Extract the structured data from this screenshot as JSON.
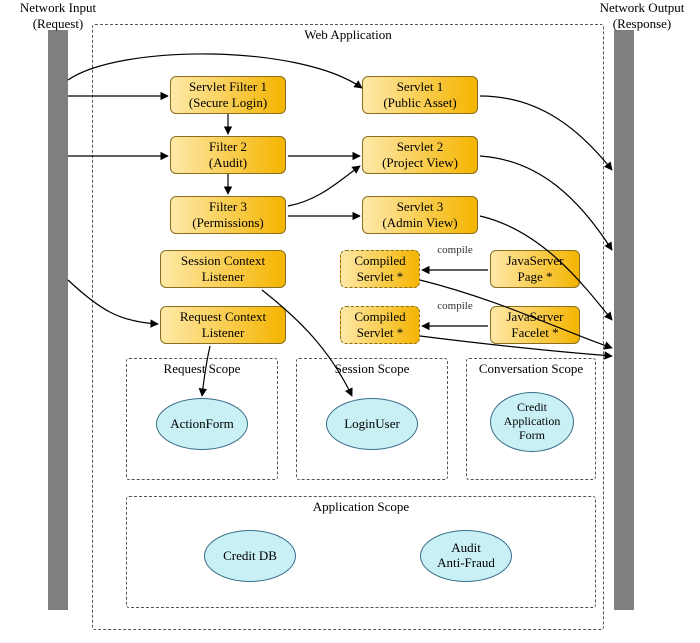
{
  "labels": {
    "network_input": "Network Input\n(Request)",
    "network_output": "Network Output\n(Response)",
    "web_application": "Web Application",
    "compile": "compile"
  },
  "filters": {
    "f1": "Servlet Filter 1\n(Secure Login)",
    "f2": "Filter 2\n(Audit)",
    "f3": "Filter 3\n(Permissions)"
  },
  "servlets": {
    "s1": "Servlet 1\n(Public Asset)",
    "s2": "Servlet 2\n(Project View)",
    "s3": "Servlet 3\n(Admin View)"
  },
  "listeners": {
    "session": "Session Context\nListener",
    "request": "Request Context\nListener"
  },
  "compiled": {
    "c1": "Compiled\nServlet *",
    "c2": "Compiled\nServlet *"
  },
  "sources": {
    "jsp": "JavaServer\nPage *",
    "jsf": "JavaServer\nFacelet *"
  },
  "scopes": {
    "request": "Request Scope",
    "session": "Session Scope",
    "conversation": "Conversation Scope",
    "application": "Application Scope"
  },
  "beans": {
    "actionform": "ActionForm",
    "loginuser": "LoginUser",
    "creditform": "Credit\nApplication\nForm",
    "creditdb": "Credit DB",
    "audit": "Audit\nAnti-Fraud"
  },
  "colors": {
    "bar": "#7f7f7f",
    "nodeBorder": "#8a6d1f",
    "ellipseFill": "#c8f0f5"
  }
}
